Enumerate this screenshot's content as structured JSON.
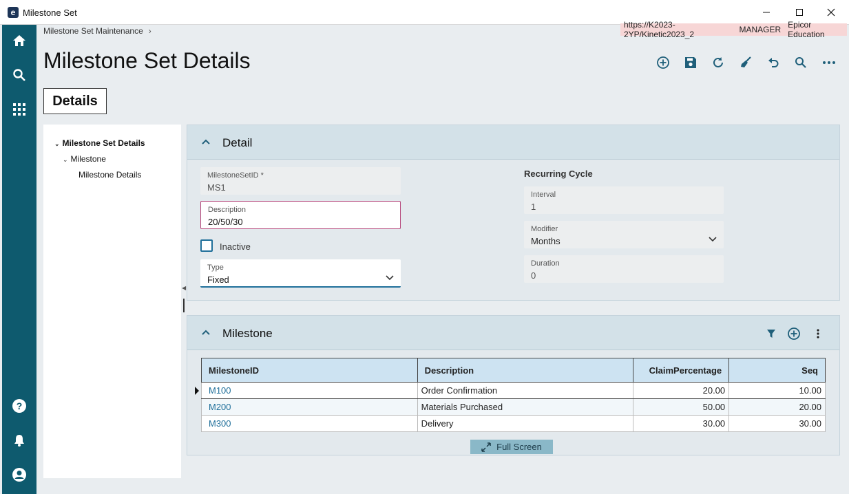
{
  "window": {
    "title": "Milestone Set",
    "logo_letter": "e"
  },
  "breadcrumb": {
    "label": "Milestone Set Maintenance",
    "separator": "›"
  },
  "environment": {
    "url": "https://K2023-2YP/Kinetic2023_2",
    "user": "MANAGER",
    "company": "Epicor Education"
  },
  "page": {
    "title": "Milestone Set Details",
    "tab_label": "Details"
  },
  "tree": {
    "root": "Milestone Set Details",
    "child": "Milestone",
    "grandchild": "Milestone Details"
  },
  "detail_panel": {
    "title": "Detail",
    "milestone_set_id": {
      "label": "MilestoneSetID *",
      "value": "MS1"
    },
    "description": {
      "label": "Description",
      "value": "20/50/30"
    },
    "inactive": {
      "label": "Inactive",
      "checked": false
    },
    "type": {
      "label": "Type",
      "value": "Fixed"
    },
    "recurring": {
      "heading": "Recurring Cycle",
      "interval": {
        "label": "Interval",
        "value": "1"
      },
      "modifier": {
        "label": "Modifier",
        "value": "Months"
      },
      "duration": {
        "label": "Duration",
        "value": "0"
      }
    }
  },
  "milestone_panel": {
    "title": "Milestone",
    "columns": [
      "MilestoneID",
      "Description",
      "ClaimPercentage",
      "Seq"
    ],
    "rows": [
      {
        "id": "M100",
        "description": "Order Confirmation",
        "claim": "20.00",
        "seq": "10.00"
      },
      {
        "id": "M200",
        "description": "Materials Purchased",
        "claim": "50.00",
        "seq": "20.00"
      },
      {
        "id": "M300",
        "description": "Delivery",
        "claim": "30.00",
        "seq": "30.00"
      }
    ],
    "fullscreen_label": "Full Screen"
  },
  "colors": {
    "nav": "#0e5a6e",
    "accent": "#0e5a6e",
    "link": "#1f6f9a",
    "env_badge": "#f7d6d6"
  }
}
